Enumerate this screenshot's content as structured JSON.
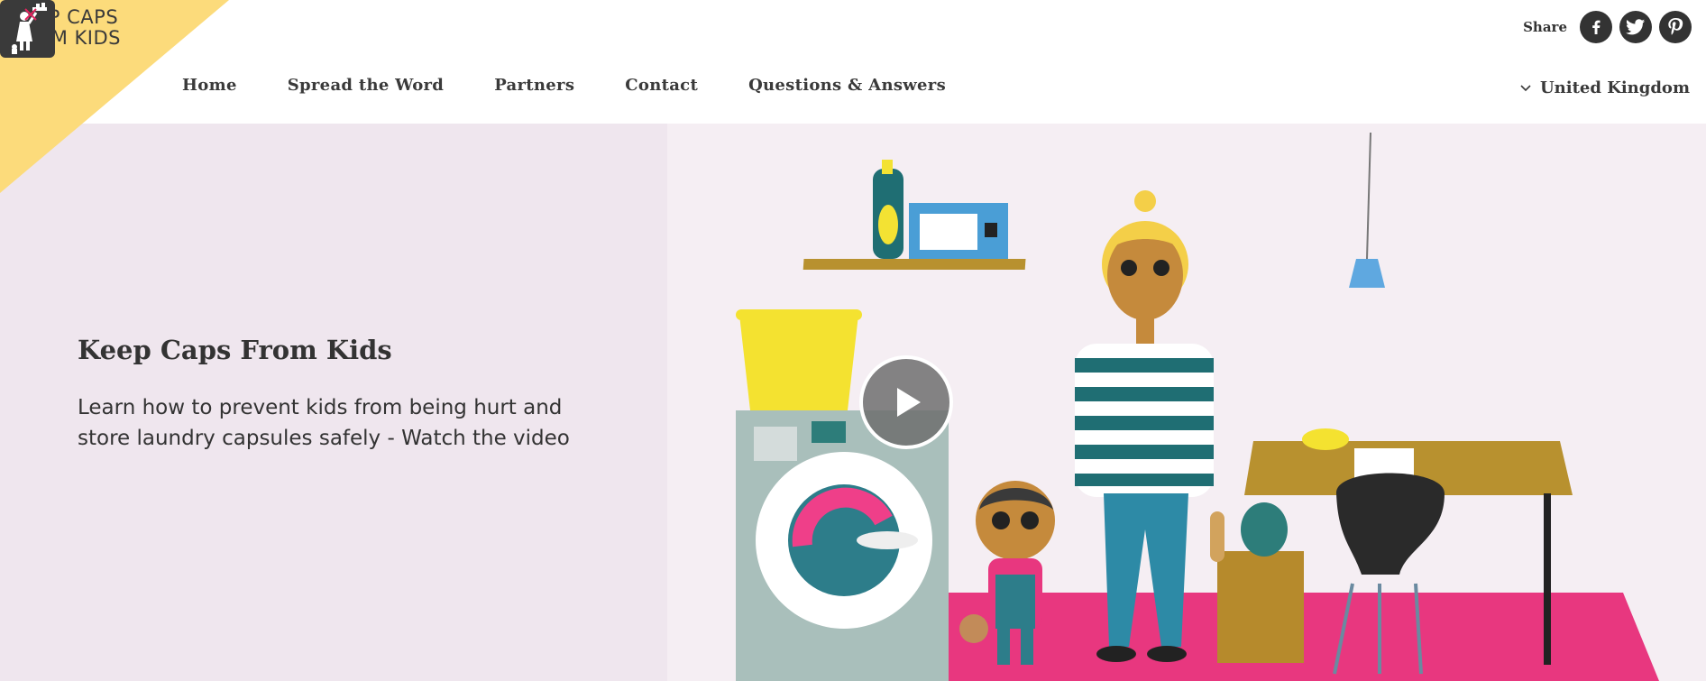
{
  "brand": {
    "logo_line1": "KEEP CAPS",
    "logo_line2": "FROM KIDS",
    "corner_color": "#fcdb7b"
  },
  "nav": {
    "items": [
      {
        "label": "Home"
      },
      {
        "label": "Spread the Word"
      },
      {
        "label": "Partners"
      },
      {
        "label": "Contact"
      },
      {
        "label": "Questions & Answers"
      }
    ]
  },
  "share": {
    "label": "Share",
    "networks": [
      "facebook-icon",
      "twitter-icon",
      "pinterest-icon"
    ]
  },
  "country": {
    "selected": "United Kingdom"
  },
  "hero": {
    "title": "Keep Caps From Kids",
    "subtitle": "Learn how to prevent kids from being hurt and store laundry capsules safely - Watch the video",
    "background": "#efe6ee",
    "play_icon": "play-icon"
  }
}
